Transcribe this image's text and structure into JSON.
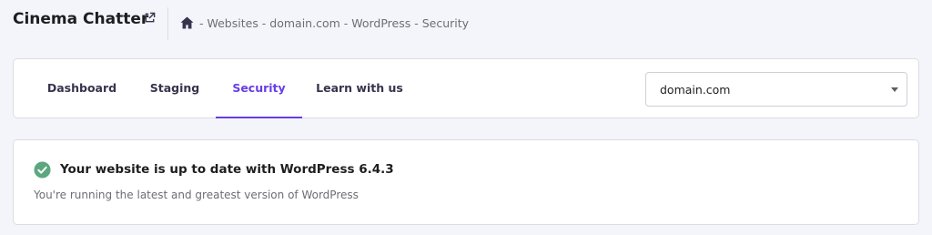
{
  "header": {
    "site_title": "Cinema Chatter",
    "external_link_icon": "external-link-icon",
    "home_icon": "home-icon",
    "breadcrumb": "- Websites - domain.com - WordPress - Security"
  },
  "tabs": [
    {
      "label": "Dashboard",
      "active": false
    },
    {
      "label": "Staging",
      "active": false
    },
    {
      "label": "Security",
      "active": true
    },
    {
      "label": "Learn with us",
      "active": false
    }
  ],
  "domain_select": {
    "selected": "domain.com",
    "icon": "chevron-down-icon"
  },
  "status": {
    "icon": "check-circle-icon",
    "title": "Your website is up to date with WordPress 6.4.3",
    "description": "You're running the latest and greatest version of WordPress"
  },
  "colors": {
    "accent": "#673de6",
    "success": "#00b090",
    "background": "#f4f4fb"
  }
}
